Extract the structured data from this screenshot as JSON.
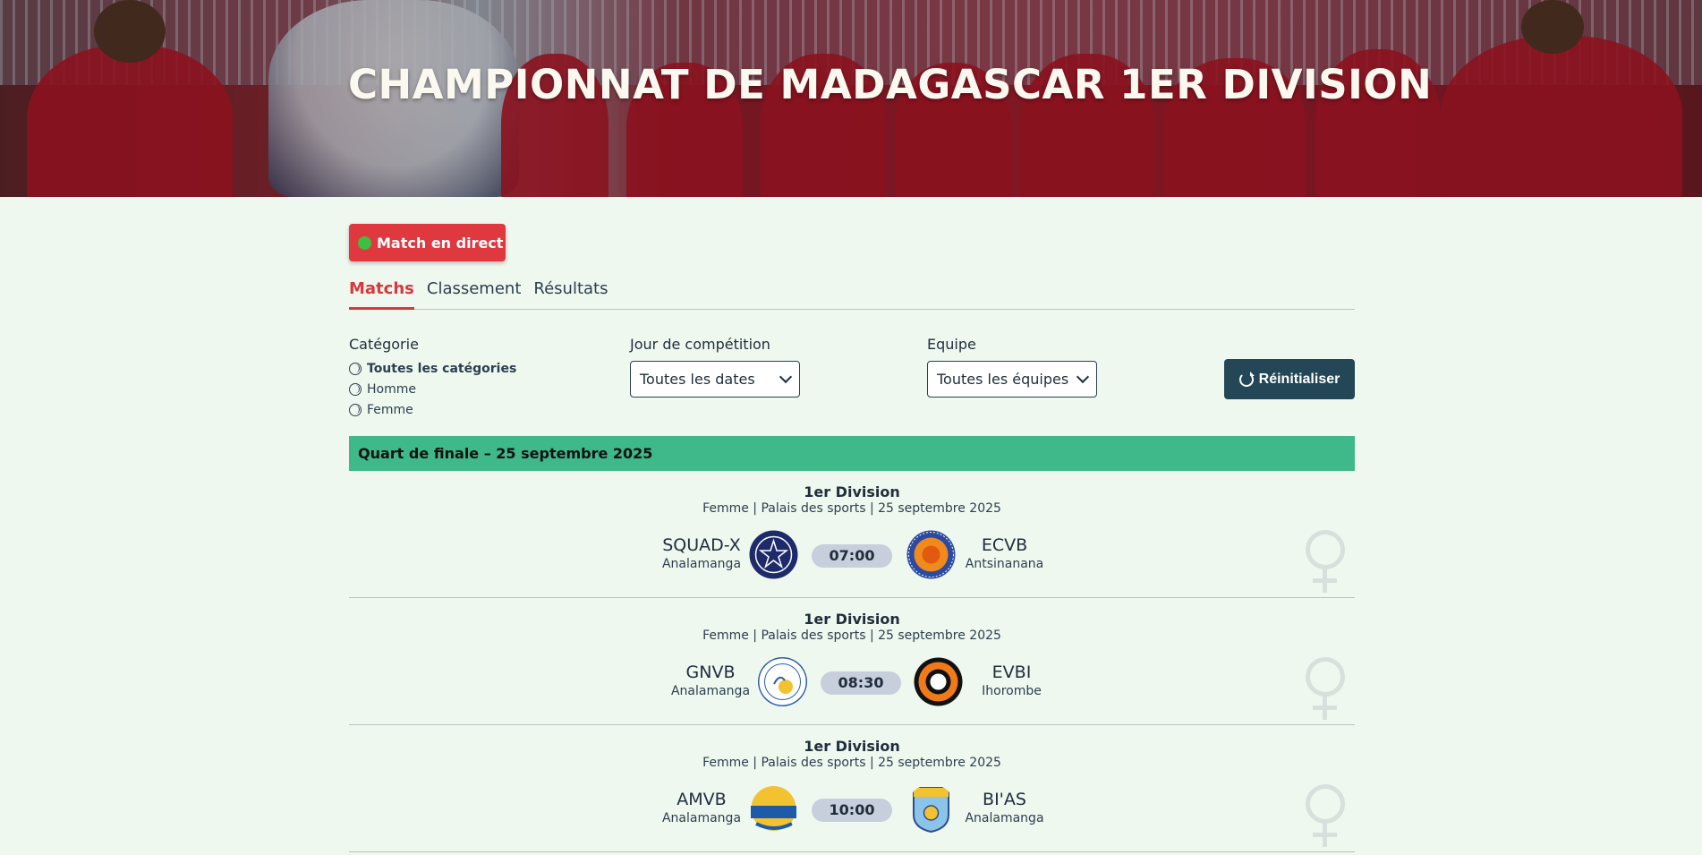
{
  "hero": {
    "title": "CHAMPIONNAT DE MADAGASCAR 1ER DIVISION"
  },
  "live_button": {
    "label": "Match en direct"
  },
  "tabs": [
    {
      "label": "Matchs",
      "active": true
    },
    {
      "label": "Classement",
      "active": false
    },
    {
      "label": "Résultats",
      "active": false
    }
  ],
  "filters": {
    "category": {
      "label": "Catégorie",
      "options": [
        "Toutes les catégories",
        "Homme",
        "Femme"
      ],
      "selected": "Toutes les catégories"
    },
    "day": {
      "label": "Jour de compétition",
      "value": "Toutes les dates"
    },
    "team": {
      "label": "Equipe",
      "value": "Toutes les équipes"
    },
    "reset_label": "Réinitialiser"
  },
  "round": {
    "title": "Quart de finale – 25 septembre 2025"
  },
  "matches": [
    {
      "division": "1er Division",
      "meta": "Femme | Palais des sports | 25 septembre 2025",
      "home": {
        "name": "SQUAD-X",
        "region": "Analamanga"
      },
      "away": {
        "name": "ECVB",
        "region": "Antsinanana"
      },
      "time": "07:00"
    },
    {
      "division": "1er Division",
      "meta": "Femme | Palais des sports | 25 septembre 2025",
      "home": {
        "name": "GNVB",
        "region": "Analamanga"
      },
      "away": {
        "name": "EVBI",
        "region": "Ihorombe"
      },
      "time": "08:30"
    },
    {
      "division": "1er Division",
      "meta": "Femme | Palais des sports | 25 septembre 2025",
      "home": {
        "name": "AMVB",
        "region": "Analamanga"
      },
      "away": {
        "name": "BI'AS",
        "region": "Analamanga"
      },
      "time": "10:00"
    }
  ],
  "colors": {
    "accent": "#d9373d",
    "round_header": "#3fb88a",
    "reset_button": "#244757",
    "background": "#eef8ee"
  }
}
